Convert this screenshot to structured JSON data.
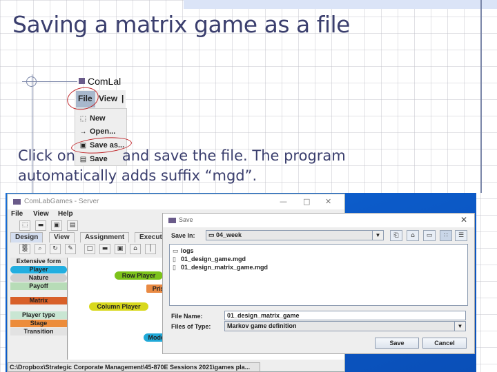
{
  "slide": {
    "title": "Saving a matrix game as a file",
    "body_line1_before": "Click on",
    "body_line1_after": "and save the file. The program",
    "body_line2": "automatically adds suffix “mgd”."
  },
  "menu_snippet": {
    "app_title": "ComLal",
    "menubar": [
      "File",
      "View",
      "|"
    ],
    "items": [
      {
        "icon": "new-file-icon",
        "glyph": "⬚",
        "label": "New"
      },
      {
        "icon": "open-icon",
        "glyph": "→",
        "label": "Open..."
      },
      {
        "icon": "save-as-icon",
        "glyph": "▣",
        "label": "Save as..."
      },
      {
        "icon": "save-icon",
        "glyph": "▤",
        "label": "Save"
      }
    ],
    "highlight_color": "#c0262a"
  },
  "main_window": {
    "title": "ComLabGames - Server",
    "controls": {
      "minimize": "—",
      "maximize": "□",
      "close": "✕"
    },
    "menu": [
      "File",
      "View",
      "Help"
    ],
    "toolbar1": [
      "⬚",
      "▬",
      "▣",
      "▤"
    ],
    "tabs": [
      "Design",
      "View",
      "Assignment",
      "Executi"
    ],
    "toolbar2": [
      "▒",
      "⌕",
      "↻",
      "✎",
      "□",
      "▬",
      "▣",
      "⌂",
      "│"
    ],
    "palette": [
      {
        "label": "Extensive form",
        "color": "#e8e8e8"
      },
      {
        "label": "Player",
        "color": "#22aee0"
      },
      {
        "label": "Nature",
        "color": "#cfcfcf"
      },
      {
        "label": "Payoff",
        "color": "#b7dcb7"
      },
      {
        "label": "Matrix",
        "color": "#d8602a"
      },
      {
        "label": "Player type",
        "color": "#c9e6d3"
      },
      {
        "label": "Stage",
        "color": "#ec8c3a"
      },
      {
        "label": "Transition",
        "color": "#e2e2e2"
      }
    ],
    "canvas_nodes": [
      {
        "label": "Row Player",
        "color": "#7cc21a"
      },
      {
        "label": "Prisu",
        "color": "#e98a43"
      },
      {
        "label": "Column Player",
        "color": "#d8d81c"
      },
      {
        "label": "Moder",
        "color": "#20a9d8"
      }
    ],
    "status_path": "C:\\Dropbox\\Strategic Corporate Management\\45-870E Sessions 2021\\games pla..."
  },
  "save_dialog": {
    "title": "Save",
    "close": "✕",
    "save_in_label": "Save In:",
    "save_in_value": "04_week",
    "nav_buttons": [
      "up-folder-icon",
      "home-icon",
      "new-folder-icon",
      "list-view-icon",
      "details-view-icon"
    ],
    "nav_glyphs": [
      "⎗",
      "⌂",
      "▭",
      "∷",
      "☰"
    ],
    "files": [
      {
        "type": "folder",
        "glyph": "▭",
        "name": "logs"
      },
      {
        "type": "file",
        "glyph": "▯",
        "name": "01_design_game.mgd"
      },
      {
        "type": "file",
        "glyph": "▯",
        "name": "01_design_matrix_game.mgd"
      }
    ],
    "file_name_label": "File Name:",
    "file_name_value": "01_design_matrix_game",
    "file_type_label": "Files of Type:",
    "file_type_value": "Markov game definition",
    "save_button": "Save",
    "cancel_button": "Cancel"
  }
}
